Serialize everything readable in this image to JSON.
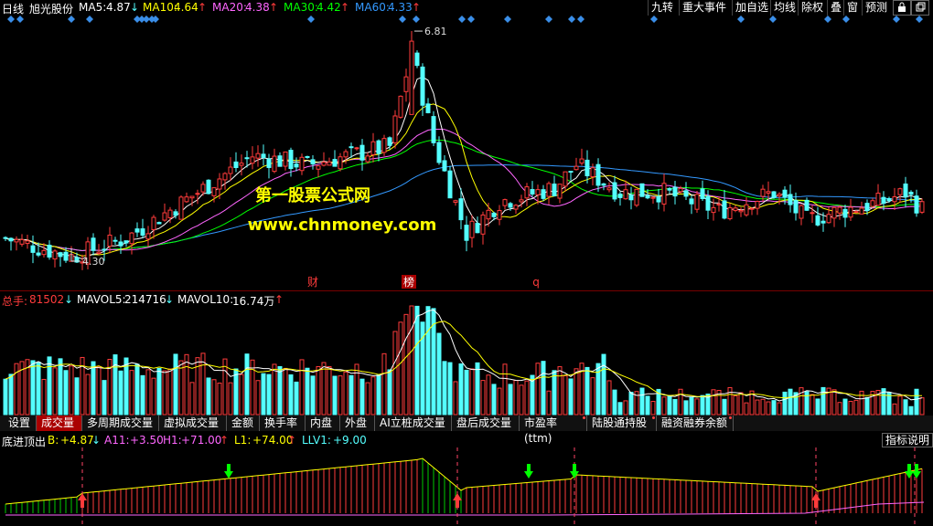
{
  "main_legend": {
    "period": "日线",
    "stock_name": "旭光股份",
    "ma5_label": "MA5:",
    "ma5_value": "4.87",
    "ma5_arrow": "↓",
    "ma10_label": "MA10:",
    "ma10_value": "4.64",
    "ma10_arrow": "↑",
    "ma20_label": "MA20:",
    "ma20_value": "4.38",
    "ma20_arrow": "↑",
    "ma30_label": "MA30:",
    "ma30_value": "4.42",
    "ma30_arrow": "↑",
    "ma60_label": "MA60:",
    "ma60_value": "4.33",
    "ma60_arrow": "↑"
  },
  "toolbar": [
    "九转",
    "重大事件",
    "加自选",
    "均线",
    "除权",
    "叠",
    "窗",
    "预测"
  ],
  "toolbar_icons": [
    "lock-icon",
    "restore-icon"
  ],
  "annotations": {
    "high_price": "6.81",
    "low_price": "4.30",
    "watermark_title": "第一股票公式网",
    "watermark_url": "www.chnmoney.com",
    "event_labels": [
      "财",
      "榜",
      "q"
    ]
  },
  "volume_legend": {
    "label": "总手:",
    "value": "81502",
    "arrow": "↓",
    "mavol5_label": "MAVOL5:",
    "mavol5_value": "214716",
    "mavol5_arrow": "↓",
    "mavol10_label": "MAVOL10:",
    "mavol10_value": "16.74万",
    "mavol10_arrow": "↑"
  },
  "tabs": [
    {
      "label": "设置",
      "active": false,
      "dot": false
    },
    {
      "label": "成交量",
      "active": true,
      "dot": false
    },
    {
      "label": "多周期成交量",
      "active": false,
      "dot": false
    },
    {
      "label": "虚拟成交量",
      "active": false,
      "dot": false
    },
    {
      "label": "金额",
      "active": false,
      "dot": false
    },
    {
      "label": "换手率",
      "active": false,
      "dot": false
    },
    {
      "label": "内盘",
      "active": false,
      "dot": false
    },
    {
      "label": "外盘",
      "active": false,
      "dot": false
    },
    {
      "label": "AI立桩成交量",
      "active": false,
      "dot": false
    },
    {
      "label": "盘后成交量",
      "active": false,
      "dot": false
    },
    {
      "label": "市盈率(ttm)",
      "active": false,
      "dot": true
    },
    {
      "label": "陆股通持股",
      "active": false,
      "dot": true
    },
    {
      "label": "融资融券余额",
      "active": false,
      "dot": true
    }
  ],
  "indicator_legend": {
    "name": "底进顶出",
    "b_label": "B:",
    "b_value": "+4.87",
    "b_arrow": "↓",
    "a11_label": "A11:",
    "a11_value": "+3.50",
    "h1_label": "H1:",
    "h1_value": "+71.00",
    "h1_arrow": "↑",
    "l1_label": "L1:",
    "l1_value": "+74.00",
    "l1_arrow": "↑",
    "llv1_label": "LLV1:",
    "llv1_value": "+9.00",
    "help_button": "指标说明"
  },
  "colors": {
    "up": "#ff3b3b",
    "down": "#54ffff",
    "ma5": "#ffffff",
    "ma10": "#ffff00",
    "ma20": "#ff66ff",
    "ma30": "#00ff00",
    "ma60": "#3399ff",
    "accent": "#aa0000"
  }
}
